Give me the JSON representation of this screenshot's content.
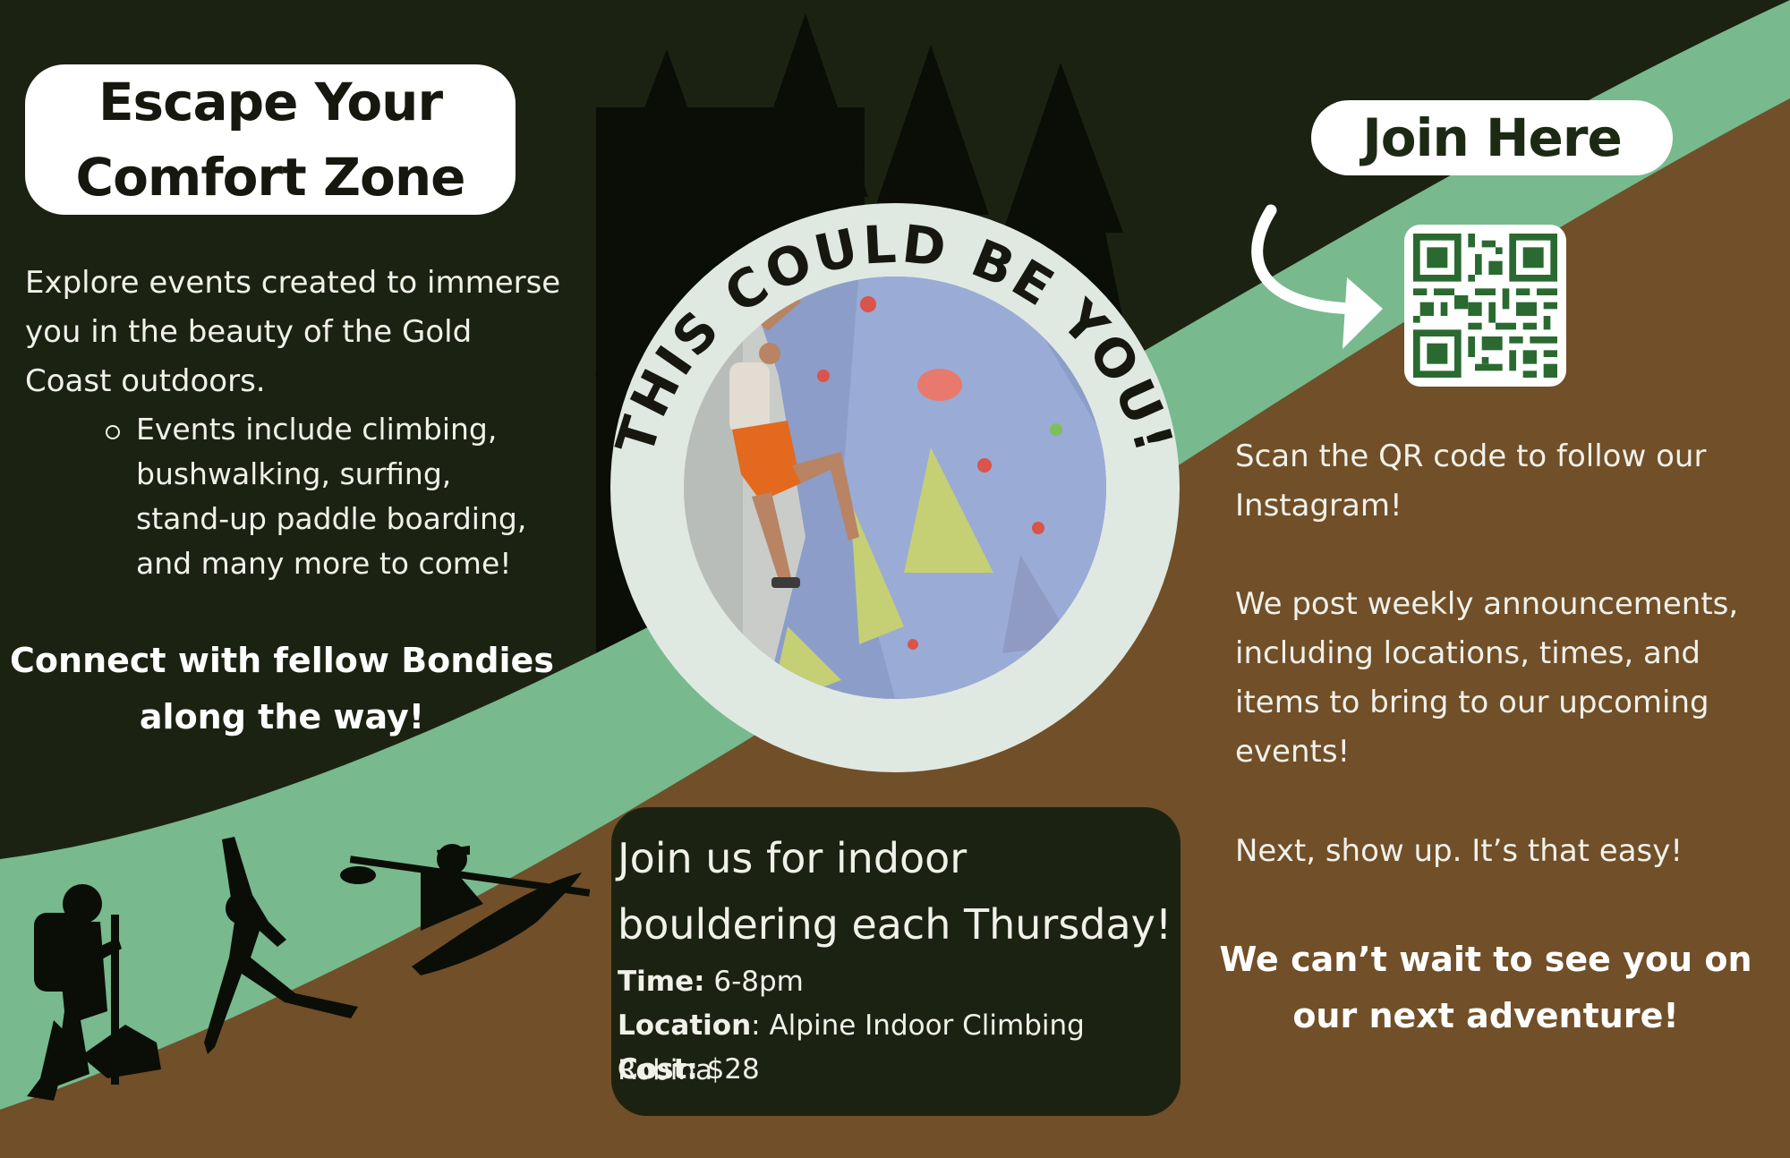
{
  "poster": {
    "title": {
      "line1": "Escape Your",
      "line2": "Comfort Zone"
    },
    "intro": "Explore events created to immerse you in the beauty of the Gold Coast outdoors.",
    "bullet": "Events include climbing, bushwalking, surfing, stand-up paddle boarding, and many more to come!",
    "connect": "Connect with fellow Bondies along the way!",
    "circle_text": "THIS COULD BE YOU!",
    "join_button": "Join Here",
    "scan_text": "Scan the QR code to follow our Instagram!",
    "weekly_text": "We post weekly announcements, including locations, times, and items to bring to our upcoming events!",
    "show_up_text": "Next, show up. It’s that easy!",
    "closing_text": "We can’t wait to see you on our next adventure!",
    "event": {
      "heading": "Join us for indoor bouldering each Thursday!",
      "time_label": "Time:",
      "time_value": "6-8pm",
      "location_label": "Location",
      "location_value": ": Alpine Indoor Climbing Robina",
      "cost_label": "Cost:",
      "cost_value": "$28"
    }
  },
  "colors": {
    "dark_green": "#1c2212",
    "light_green": "#78b98e",
    "brown": "#714f28",
    "white": "#ffffff",
    "qr_green": "#2a6a30"
  },
  "icons": [
    "pine-tree-icon",
    "hiker-icon",
    "yoga-icon",
    "kayaker-icon",
    "curved-arrow-icon",
    "qr-code-icon"
  ]
}
